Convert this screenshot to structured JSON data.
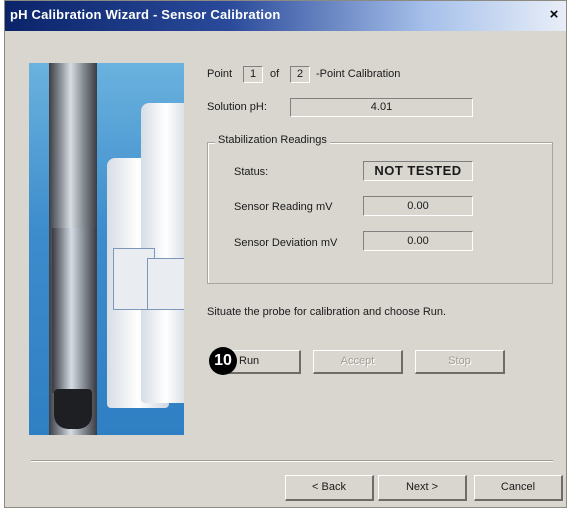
{
  "window": {
    "title": "pH Calibration Wizard - Sensor Calibration",
    "close_glyph": "×"
  },
  "point": {
    "label_prefix": "Point",
    "current": "1",
    "label_of": "of",
    "total": "2",
    "label_suffix": "-Point Calibration"
  },
  "solution": {
    "label": "Solution pH:",
    "value": "4.01"
  },
  "stabilization": {
    "caption": "Stabilization Readings",
    "status_label": "Status:",
    "status_value": "NOT TESTED",
    "sensor_reading_label": "Sensor Reading mV",
    "sensor_reading_value": "0.00",
    "sensor_deviation_label": "Sensor Deviation mV",
    "sensor_deviation_value": "0.00"
  },
  "instruction": "Situate the probe for calibration and choose Run.",
  "callout": "10",
  "actions": {
    "run": "Run",
    "accept": "Accept",
    "stop": "Stop"
  },
  "footer": {
    "back": "< Back",
    "next": "Next >",
    "cancel": "Cancel"
  },
  "colors": {
    "titlebar": "#0a246a",
    "dialog_bg": "#d8d6cf"
  },
  "icons": {
    "close": "close-icon"
  }
}
